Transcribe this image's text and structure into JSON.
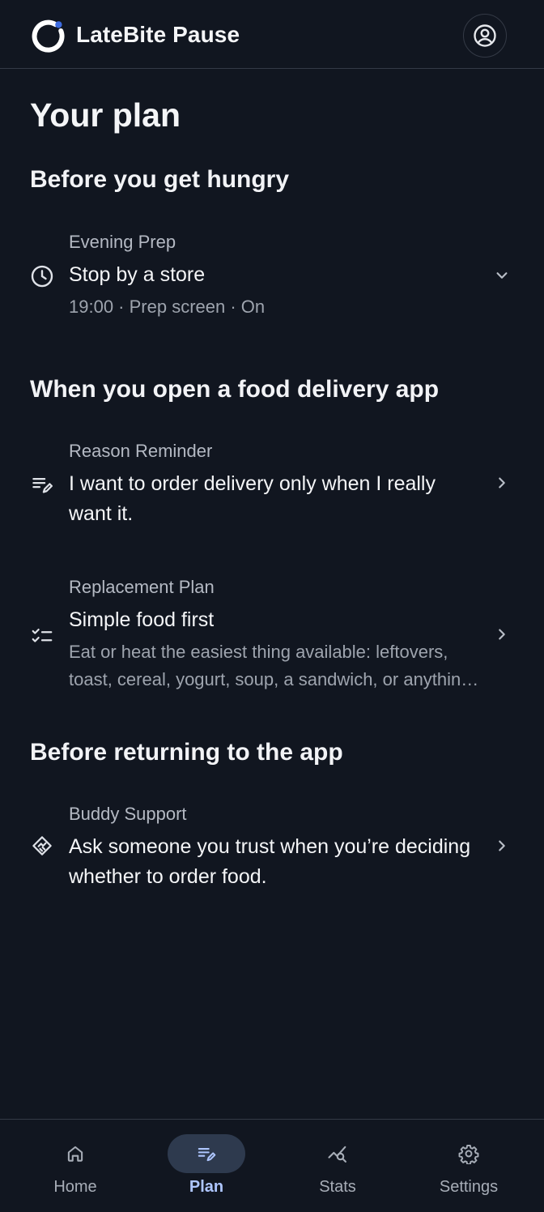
{
  "app": {
    "name": "LateBite Pause",
    "accent": "#3d6be0"
  },
  "header": {
    "avatar_icon": "account-circle-icon"
  },
  "page": {
    "title": "Your plan"
  },
  "sections": [
    {
      "heading": "Before you get hungry",
      "items": [
        {
          "label": "Evening Prep",
          "title": "Stop by a store",
          "subtitle": "19:00 · Prep screen · On",
          "icon": "clock-icon",
          "trailing": "chevron-down-icon"
        }
      ]
    },
    {
      "heading": "When you open a food delivery app",
      "items": [
        {
          "label": "Reason Reminder",
          "title": "I want to order delivery only when I really want it.",
          "icon": "edit-note-icon",
          "trailing": "chevron-right-icon"
        },
        {
          "label": "Replacement Plan",
          "title": "Simple food first",
          "subtitle": "Eat or heat the easiest thing available: leftovers, toast, cereal, yogurt, soup, a sandwich, or anything ready to eat.",
          "icon": "checklist-icon",
          "trailing": "chevron-right-icon"
        }
      ]
    },
    {
      "heading": "Before returning to the app",
      "items": [
        {
          "label": "Buddy Support",
          "title": "Ask someone you trust when you’re deciding whether to order food.",
          "icon": "handshake-icon",
          "trailing": "chevron-right-icon"
        }
      ]
    }
  ],
  "bottom_nav": {
    "active": "Plan",
    "active_color": "#aec6ff",
    "items": [
      {
        "label": "Home",
        "icon": "home-icon"
      },
      {
        "label": "Plan",
        "icon": "edit-note-icon"
      },
      {
        "label": "Stats",
        "icon": "query-stats-icon"
      },
      {
        "label": "Settings",
        "icon": "gear-icon"
      }
    ]
  }
}
